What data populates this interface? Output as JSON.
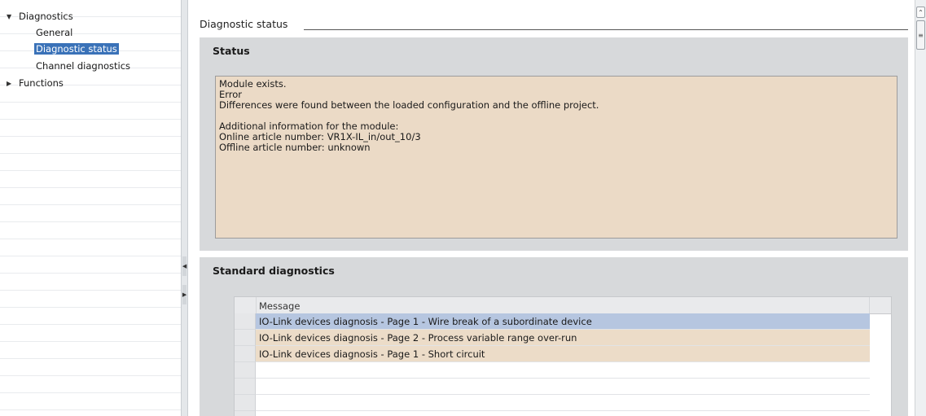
{
  "nav": {
    "items": [
      {
        "label": "Diagnostics",
        "icon": "triangle-down-icon"
      },
      {
        "label": "General"
      },
      {
        "label": "Diagnostic status"
      },
      {
        "label": "Channel diagnostics"
      },
      {
        "label": "Functions",
        "icon": "triangle-right-icon"
      }
    ],
    "selected": "Diagnostic status"
  },
  "section": {
    "title": "Diagnostic status"
  },
  "status_panel": {
    "title": "Status",
    "lines": [
      "Module exists.",
      "Error",
      "Differences were found between the loaded configuration and the offline project.",
      "",
      "Additional information for the module:",
      "Online article number:  VR1X-IL_in/out_10/3",
      "Offline article number:  unknown"
    ]
  },
  "standard_panel": {
    "title": "Standard diagnostics",
    "table": {
      "column": "Message",
      "rows": [
        "IO-Link devices diagnosis - Page 1 - Wire break of a subordinate device",
        "IO-Link devices diagnosis - Page 2 - Process variable range over-run",
        "IO-Link devices diagnosis - Page 1 - Short circuit"
      ]
    }
  },
  "colors": {
    "selection": "#3a72b8",
    "status_background": "#ebdac6",
    "row_selected": "#b6c6e0",
    "panel_background": "#d7d9db"
  }
}
